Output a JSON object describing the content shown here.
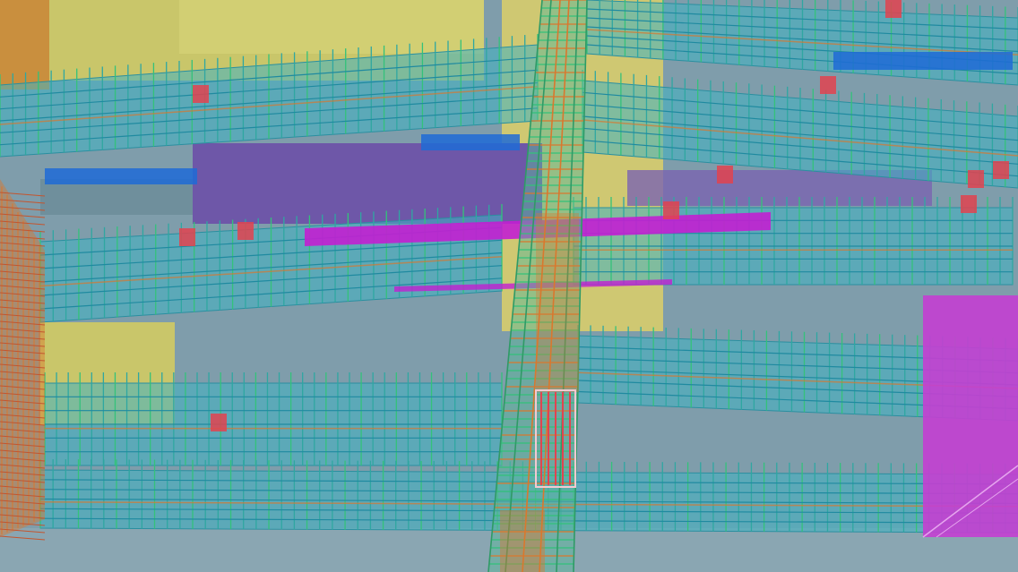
{
  "viewport": {
    "colors": {
      "background": "#7f9dab",
      "yellow_zone": "#c9c66a",
      "violet_zone": "#6e57a8",
      "magenta_panel": "#c43fd2",
      "cyan_beam": "#3fb3c3",
      "rebar_green": "#33c27a",
      "rebar_orange": "#d9782e",
      "rebar_red": "#e2434f",
      "blue_strip": "#1f6bd6",
      "magenta_strip": "#c21fd1"
    },
    "layers": [
      "column-rebar-cage",
      "beam-rebar-cages",
      "slab-zones",
      "pink-beam-strip",
      "magenta-wall-panel",
      "wall-rebar-cage"
    ]
  }
}
